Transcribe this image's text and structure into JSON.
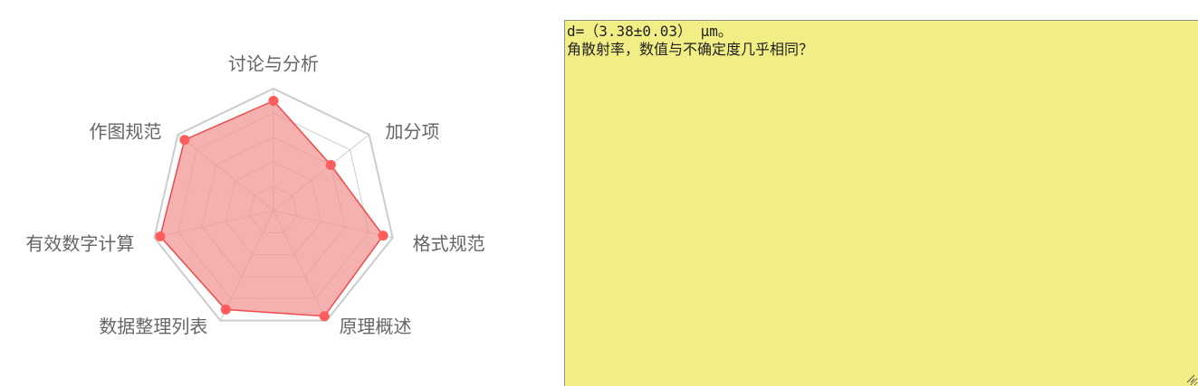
{
  "chart_data": {
    "type": "radar",
    "categories": [
      "讨论与分析",
      "加分项",
      "格式规范",
      "原理概述",
      "数据整理列表",
      "有效数字计算",
      "作图规范"
    ],
    "series": [
      {
        "values": [
          0.9,
          0.6,
          0.92,
          0.96,
          0.9,
          0.95,
          0.93
        ]
      }
    ],
    "max": 1,
    "levels": 5,
    "colors": {
      "line": "#f04a4a",
      "fill": "#f29595",
      "point": "#ff5c5c",
      "grid": "#cccccc",
      "label": "#666666"
    }
  },
  "comment": {
    "lines": [
      "d=（3.38±0.03） μm。",
      "角散射率，数值与不确定度几乎相同？"
    ]
  },
  "colors": {
    "comment_bg": "#f2ee86"
  }
}
